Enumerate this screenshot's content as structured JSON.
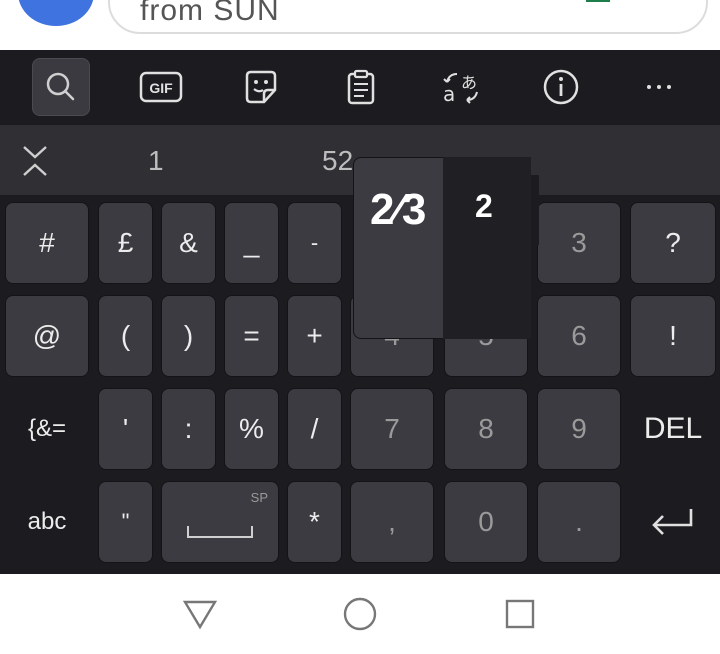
{
  "app": {
    "search_text": "from SUN"
  },
  "toolbar": {
    "gif_label": "GIF",
    "translate_label": "aあ",
    "info_label": "i",
    "more_label": "···"
  },
  "candidates": {
    "items": [
      "1",
      "52",
      "2⁄3",
      "2"
    ]
  },
  "popup": {
    "fraction": "2⁄3",
    "digit": "2"
  },
  "keys": {
    "row1": [
      "#",
      "£",
      "&",
      "_",
      "-",
      "3",
      "?"
    ],
    "row2": [
      "@",
      "(",
      ")",
      "=",
      "+",
      "4",
      "5",
      "6",
      "!"
    ],
    "row3": [
      "{&=",
      "'",
      ":",
      "%",
      "/",
      "7",
      "8",
      "9",
      "DEL"
    ],
    "row4": [
      "abc",
      "\"",
      "SP",
      "*",
      ",",
      "0",
      "."
    ]
  },
  "colors": {
    "keyboard_bg": "#1c1c20",
    "key_bg": "#3b3b41",
    "candidate_bar": "#2f2f34",
    "avatar": "#3f74e0"
  }
}
